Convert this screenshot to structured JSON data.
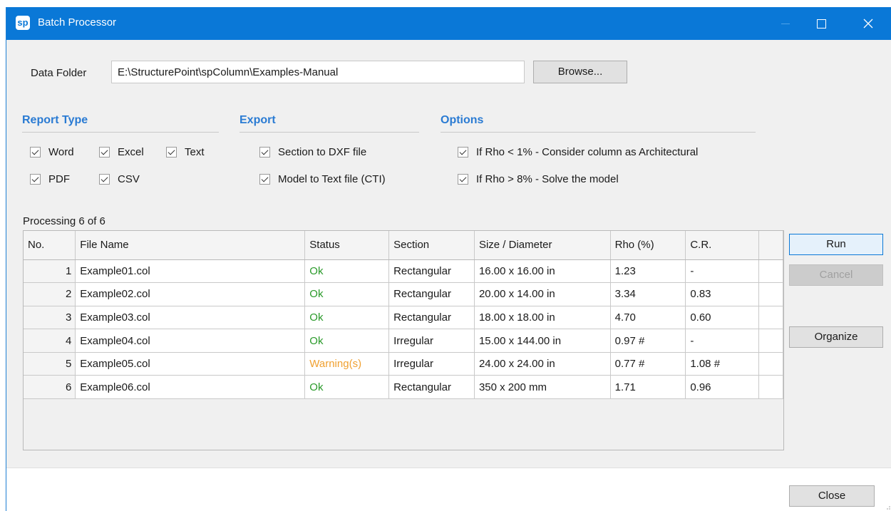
{
  "window": {
    "title": "Batch Processor",
    "logo": "sp"
  },
  "data_folder": {
    "label": "Data Folder",
    "value": "E:\\StructurePoint\\spColumn\\Examples-Manual",
    "browse_label": "Browse..."
  },
  "report_type": {
    "heading": "Report Type",
    "options": [
      {
        "label": "Word",
        "checked": true
      },
      {
        "label": "Excel",
        "checked": true
      },
      {
        "label": "Text",
        "checked": true
      },
      {
        "label": "PDF",
        "checked": true
      },
      {
        "label": "CSV",
        "checked": true
      }
    ]
  },
  "export": {
    "heading": "Export",
    "options": [
      {
        "label": "Section to DXF file",
        "checked": true
      },
      {
        "label": "Model to Text file (CTI)",
        "checked": true
      }
    ]
  },
  "options": {
    "heading": "Options",
    "items": [
      {
        "label": "If Rho < 1% - Consider column as Architectural",
        "checked": true
      },
      {
        "label": "If Rho > 8% - Solve the model",
        "checked": true
      }
    ]
  },
  "progress": {
    "text": "Processing 6 of 6"
  },
  "table": {
    "headers": [
      "No.",
      "File Name",
      "Status",
      "Section",
      "Size / Diameter",
      "Rho (%)",
      "C.R.",
      ""
    ],
    "rows": [
      {
        "no": "1",
        "file": "Example01.col",
        "status": "Ok",
        "section": "Rectangular",
        "size": "16.00 x 16.00 in",
        "rho": "1.23",
        "cr": "-"
      },
      {
        "no": "2",
        "file": "Example02.col",
        "status": "Ok",
        "section": "Rectangular",
        "size": "20.00 x 14.00 in",
        "rho": "3.34",
        "cr": "0.83"
      },
      {
        "no": "3",
        "file": "Example03.col",
        "status": "Ok",
        "section": "Rectangular",
        "size": "18.00 x 18.00 in",
        "rho": "4.70",
        "cr": "0.60"
      },
      {
        "no": "4",
        "file": "Example04.col",
        "status": "Ok",
        "section": "Irregular",
        "size": "15.00 x 144.00 in",
        "rho": "0.97 #",
        "cr": "-"
      },
      {
        "no": "5",
        "file": "Example05.col",
        "status": "Warning(s)",
        "section": "Irregular",
        "size": "24.00 x 24.00 in",
        "rho": "0.77 #",
        "cr": "1.08 #"
      },
      {
        "no": "6",
        "file": "Example06.col",
        "status": "Ok",
        "section": "Rectangular",
        "size": "350 x 200 mm",
        "rho": "1.71",
        "cr": "0.96"
      }
    ]
  },
  "buttons": {
    "run": "Run",
    "cancel": "Cancel",
    "organize": "Organize",
    "close": "Close"
  },
  "colors": {
    "titlebar": "#0a78d7",
    "heading": "#2a7bd3",
    "status_ok": "#2a9a2a",
    "status_warning": "#f0a030"
  }
}
